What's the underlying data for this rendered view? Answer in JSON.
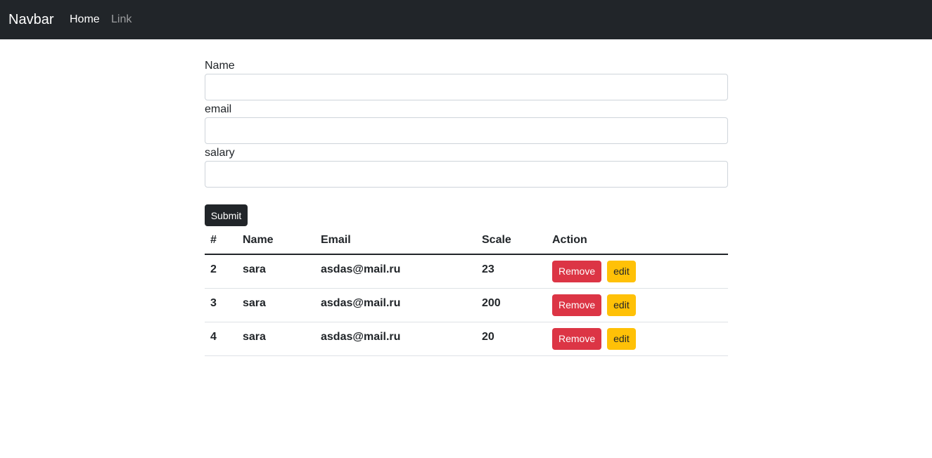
{
  "navbar": {
    "brand": "Navbar",
    "links": [
      {
        "label": "Home",
        "active": true
      },
      {
        "label": "Link",
        "active": false
      }
    ]
  },
  "form": {
    "fields": [
      {
        "label": "Name",
        "value": "",
        "placeholder": ""
      },
      {
        "label": "email",
        "value": "",
        "placeholder": ""
      },
      {
        "label": "salary",
        "value": "",
        "placeholder": ""
      }
    ],
    "submit_label": "Submit"
  },
  "table": {
    "headers": [
      "#",
      "Name",
      "Email",
      "Scale",
      "Action"
    ],
    "rows": [
      {
        "id": "2",
        "name": "sara",
        "email": "asdas@mail.ru",
        "scale": "23"
      },
      {
        "id": "3",
        "name": "sara",
        "email": "asdas@mail.ru",
        "scale": "200"
      },
      {
        "id": "4",
        "name": "sara",
        "email": "asdas@mail.ru",
        "scale": "20"
      }
    ],
    "remove_label": "Remove",
    "edit_label": "edit"
  },
  "colors": {
    "navbar_bg": "#212529",
    "remove_button": "#dc3545",
    "edit_button": "#ffc107"
  }
}
